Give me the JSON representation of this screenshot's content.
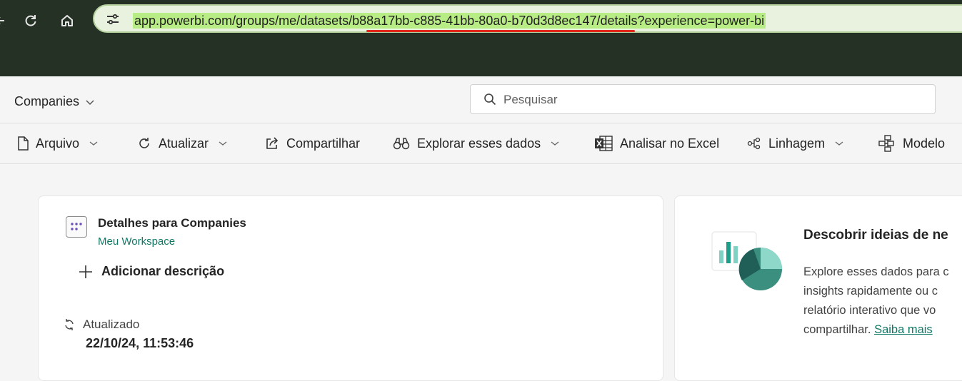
{
  "browser": {
    "url_text": "app.powerbi.com/groups/me/datasets/b88a17bb-c885-41bb-80a0-b70d3d8ec147/details?experience=power-bi",
    "colors": {
      "frame": "#253125",
      "url_highlight": "#b8ec84",
      "annotation_underline": "#e2271b"
    }
  },
  "header": {
    "workspace_title": "Companies",
    "search_placeholder": "Pesquisar"
  },
  "toolbar": {
    "arquivo": "Arquivo",
    "atualizar": "Atualizar",
    "compartilhar": "Compartilhar",
    "explorar": "Explorar esses dados",
    "analisar_excel": "Analisar no Excel",
    "linhagem": "Linhagem",
    "modelo": "Modelo"
  },
  "details_card": {
    "title": "Detalhes para Companies",
    "workspace": "Meu Workspace",
    "add_description": "Adicionar descrição",
    "refreshed_label": "Atualizado",
    "refreshed_date": "22/10/24, 11:53:46"
  },
  "discover_card": {
    "title": "Descobrir ideias de ne",
    "text_line1": "Explore esses dados para c",
    "text_line2": "insights rapidamente ou c",
    "text_line3": "relatório interativo que vo",
    "text_line4": "compartilhar.",
    "learn_more": "Saiba mais"
  },
  "icons": [
    "back-icon",
    "refresh-icon",
    "home-icon",
    "site-settings-icon",
    "chevron-down-icon",
    "search-icon",
    "file-icon",
    "refresh-icon",
    "share-icon",
    "binoculars-icon",
    "excel-icon",
    "lineage-icon",
    "model-icon",
    "dataset-icon",
    "plus-icon",
    "sync-icon"
  ],
  "accent_color": "#117865"
}
